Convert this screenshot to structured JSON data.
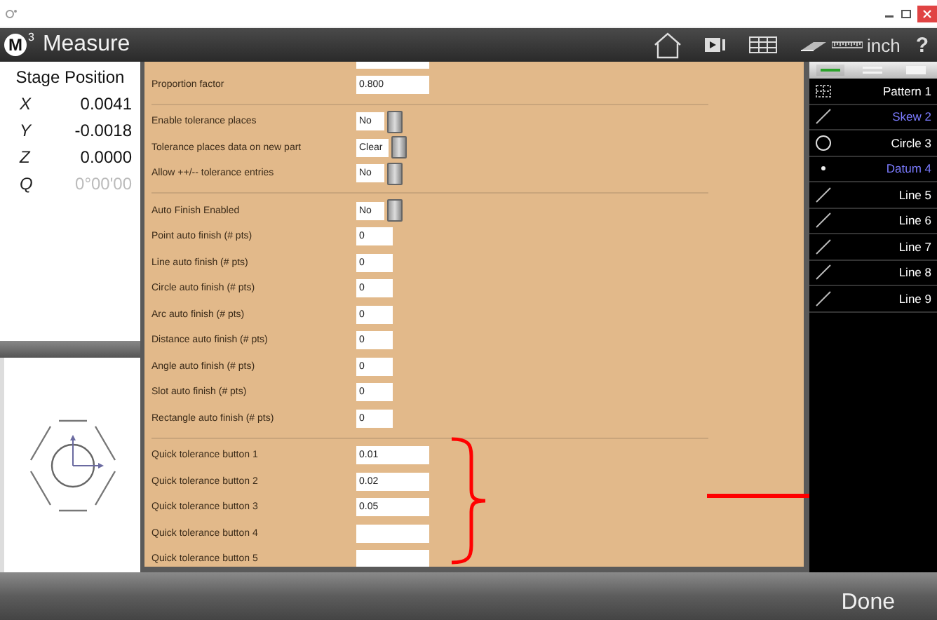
{
  "app": {
    "logo_letter": "M",
    "logo_sup": "3",
    "title": "Measure"
  },
  "toolbar": {
    "unit": "inch",
    "help": "?"
  },
  "stage": {
    "title": "Stage Position",
    "axes": [
      {
        "axis": "X",
        "value": "0.0041",
        "disabled": false
      },
      {
        "axis": "Y",
        "value": "-0.0018",
        "disabled": false
      },
      {
        "axis": "Z",
        "value": "0.0000",
        "disabled": false
      },
      {
        "axis": "Q",
        "value": "0°00'00",
        "disabled": true
      }
    ]
  },
  "settings": {
    "sections": [
      {
        "rows": [
          {
            "kind": "wide",
            "label": "Proportion factor",
            "value": "0.800"
          }
        ]
      },
      {
        "rows": [
          {
            "kind": "select",
            "label": "Enable tolerance places",
            "value": "No"
          },
          {
            "kind": "select",
            "label": "Tolerance places data on new part",
            "value": "Clear"
          },
          {
            "kind": "select",
            "label": "Allow ++/-- tolerance entries",
            "value": "No"
          }
        ]
      },
      {
        "rows": [
          {
            "kind": "select",
            "label": "Auto Finish Enabled",
            "value": "No"
          },
          {
            "kind": "narrow",
            "label": "Point auto finish (# pts)",
            "value": "0"
          },
          {
            "kind": "narrow",
            "label": "Line auto finish (# pts)",
            "value": "0"
          },
          {
            "kind": "narrow",
            "label": "Circle auto finish (# pts)",
            "value": "0"
          },
          {
            "kind": "narrow",
            "label": "Arc auto finish (# pts)",
            "value": "0"
          },
          {
            "kind": "narrow",
            "label": "Distance auto finish (# pts)",
            "value": "0"
          },
          {
            "kind": "narrow",
            "label": "Angle auto finish (# pts)",
            "value": "0"
          },
          {
            "kind": "narrow",
            "label": "Slot auto finish (# pts)",
            "value": "0"
          },
          {
            "kind": "narrow",
            "label": "Rectangle auto finish (# pts)",
            "value": "0"
          }
        ]
      },
      {
        "rows": [
          {
            "kind": "wide",
            "label": "Quick tolerance button 1",
            "value": "0.01"
          },
          {
            "kind": "wide",
            "label": "Quick tolerance button 2",
            "value": "0.02"
          },
          {
            "kind": "wide",
            "label": "Quick tolerance button 3",
            "value": "0.05"
          },
          {
            "kind": "wide",
            "label": "Quick tolerance button 4"
          },
          {
            "kind": "wide",
            "label": "Quick tolerance button 5"
          }
        ]
      }
    ]
  },
  "feature_list": {
    "view_tabs": [
      {
        "kind": "line",
        "selected": true
      },
      {
        "kind": "double",
        "selected": false
      },
      {
        "kind": "block",
        "selected": false
      }
    ],
    "items": [
      {
        "kind": "pattern",
        "label": "Pattern 1",
        "color": "#ffffff"
      },
      {
        "kind": "line",
        "label": "Skew 2",
        "color": "#7b7bff"
      },
      {
        "kind": "circle",
        "label": "Circle 3",
        "color": "#ffffff"
      },
      {
        "kind": "point",
        "label": "Datum 4",
        "color": "#7b7bff"
      },
      {
        "kind": "line",
        "label": "Line 5",
        "color": "#ffffff"
      },
      {
        "kind": "line",
        "label": "Line 6",
        "color": "#ffffff"
      },
      {
        "kind": "line",
        "label": "Line 7",
        "color": "#ffffff"
      },
      {
        "kind": "line",
        "label": "Line 8",
        "color": "#ffffff"
      },
      {
        "kind": "line",
        "label": "Line 9",
        "color": "#ffffff"
      }
    ]
  },
  "footer": {
    "done": "Done"
  }
}
